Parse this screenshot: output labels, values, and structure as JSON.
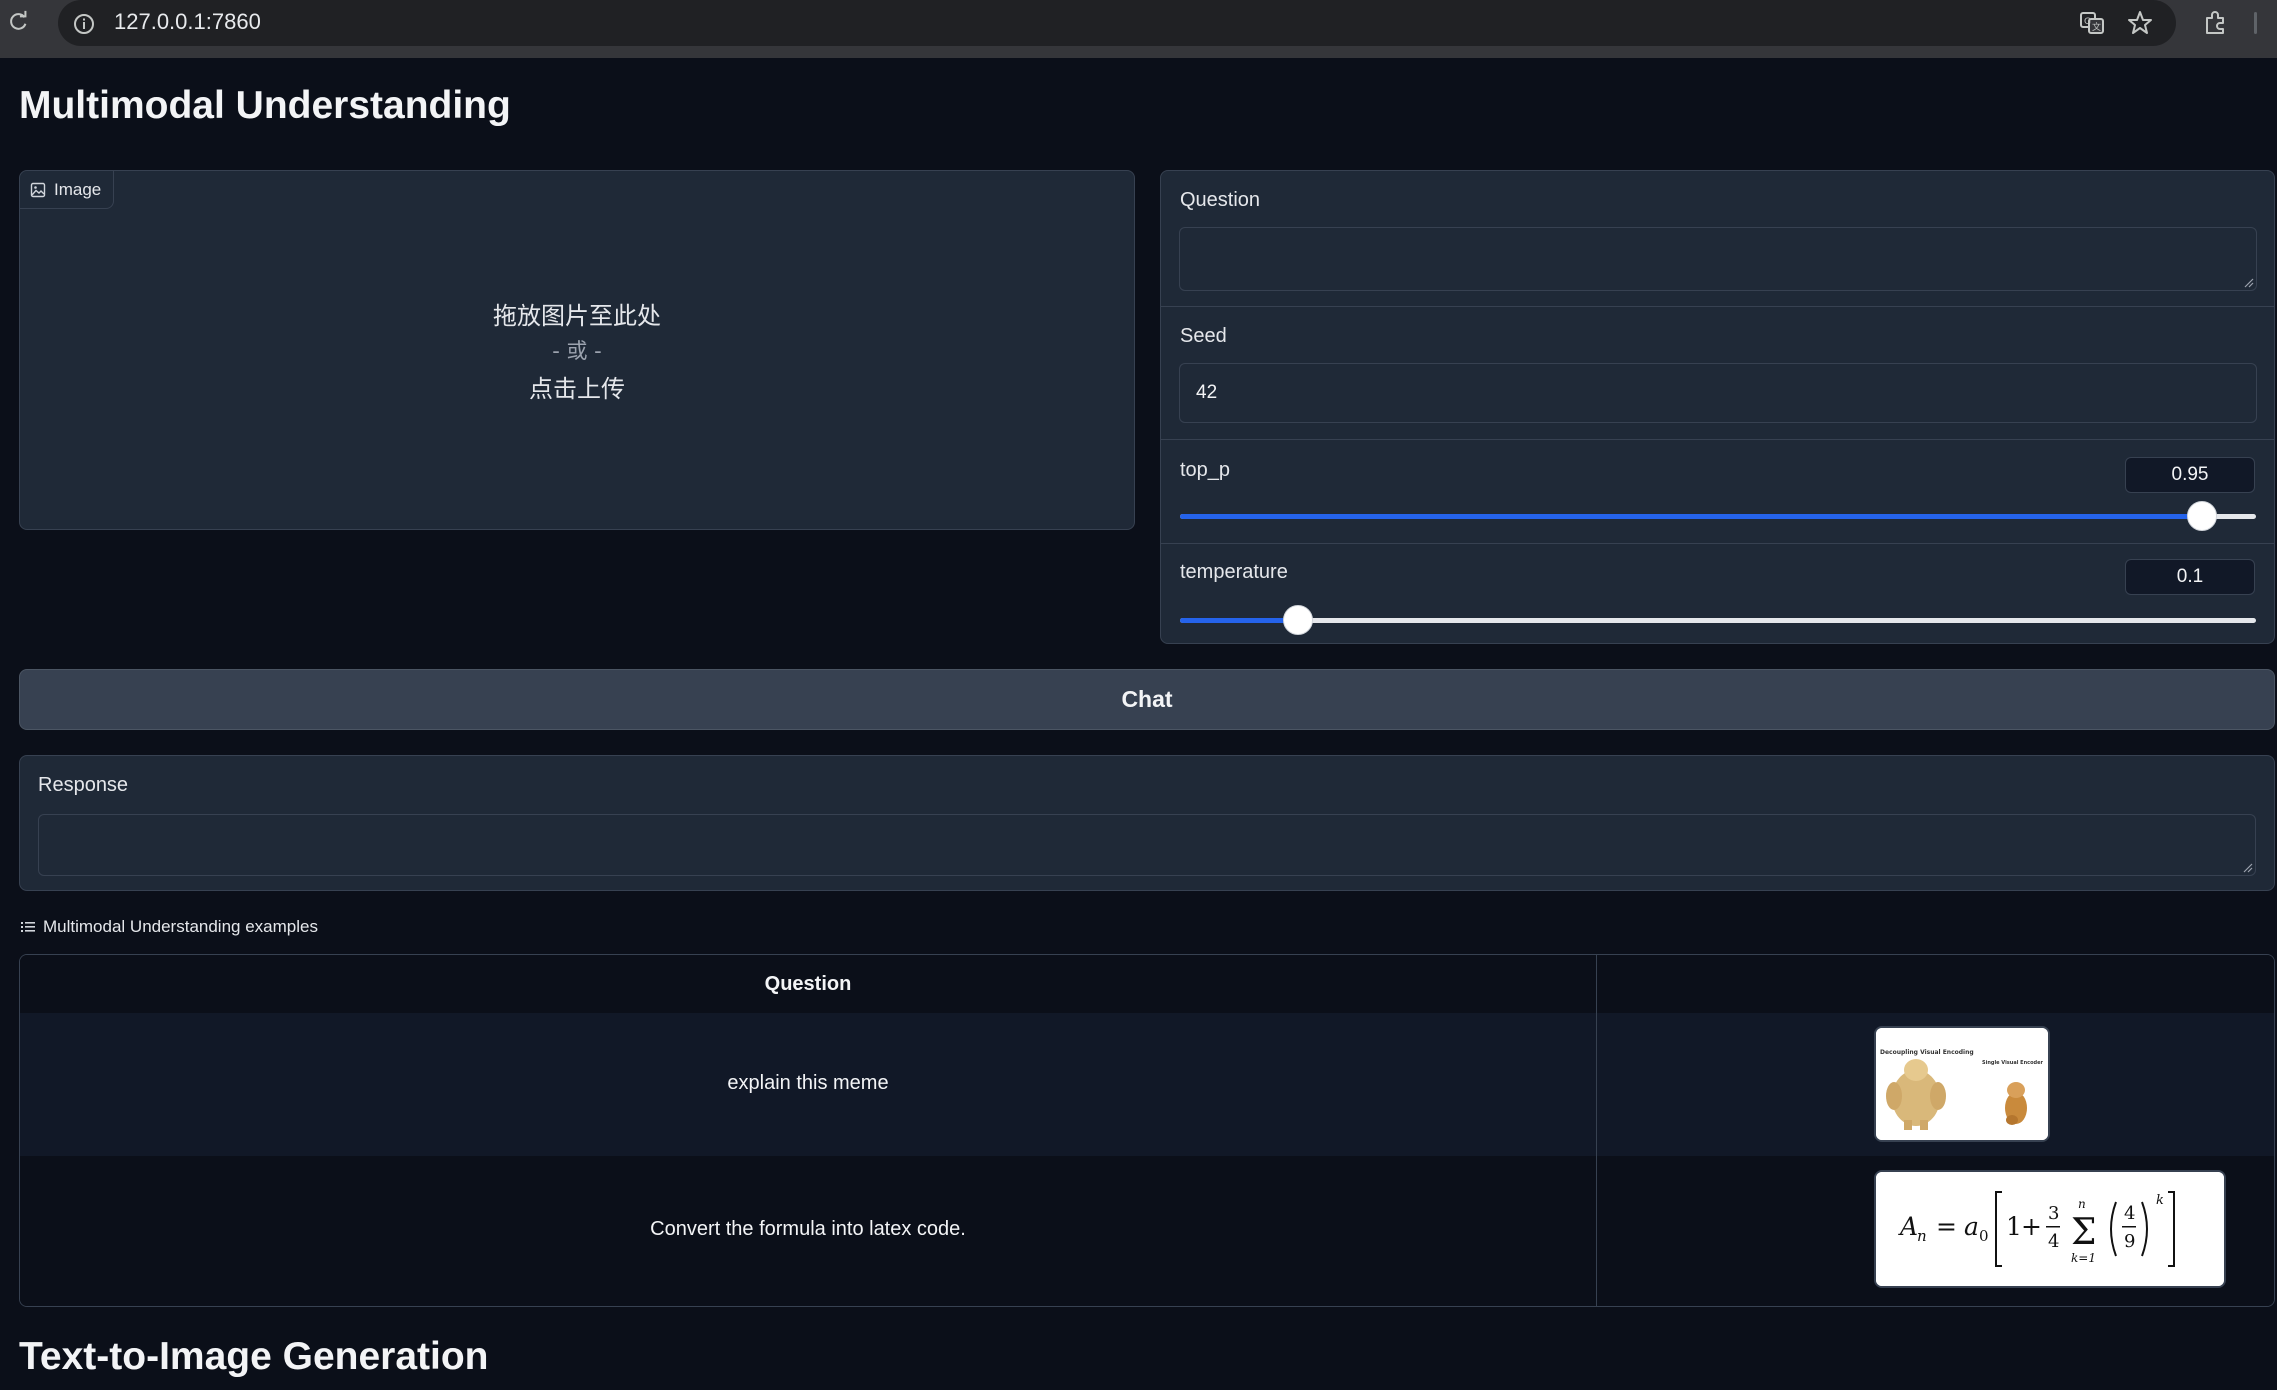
{
  "browser": {
    "url": "127.0.0.1:7860"
  },
  "understanding": {
    "title": "Multimodal Understanding",
    "image_label": "Image",
    "upload": {
      "drop_text": "拖放图片至此处",
      "or_text": "- 或 -",
      "click_text": "点击上传"
    },
    "question_label": "Question",
    "question_value": "",
    "seed_label": "Seed",
    "seed_value": "42",
    "top_p": {
      "label": "top_p",
      "value": "0.95",
      "fraction": 0.95
    },
    "temperature": {
      "label": "temperature",
      "value": "0.1",
      "fraction": 0.11
    },
    "chat_button": "Chat",
    "response_label": "Response",
    "response_value": ""
  },
  "examples": {
    "label": "Multimodal Understanding examples",
    "header_question": "Question",
    "header_image": "",
    "rows": [
      {
        "question": "explain this meme",
        "image": "meme-thumbnail"
      },
      {
        "question": "Convert the formula into latex code.",
        "image": "formula-thumbnail"
      }
    ],
    "meme_captions": [
      "Decoupling Visual Encoding",
      "Single Visual Encoder"
    ]
  },
  "generation": {
    "title": "Text-to-Image Generation"
  },
  "colors": {
    "background": "#0b0f19",
    "panel": "#1f2937",
    "accent": "#2563eb"
  }
}
